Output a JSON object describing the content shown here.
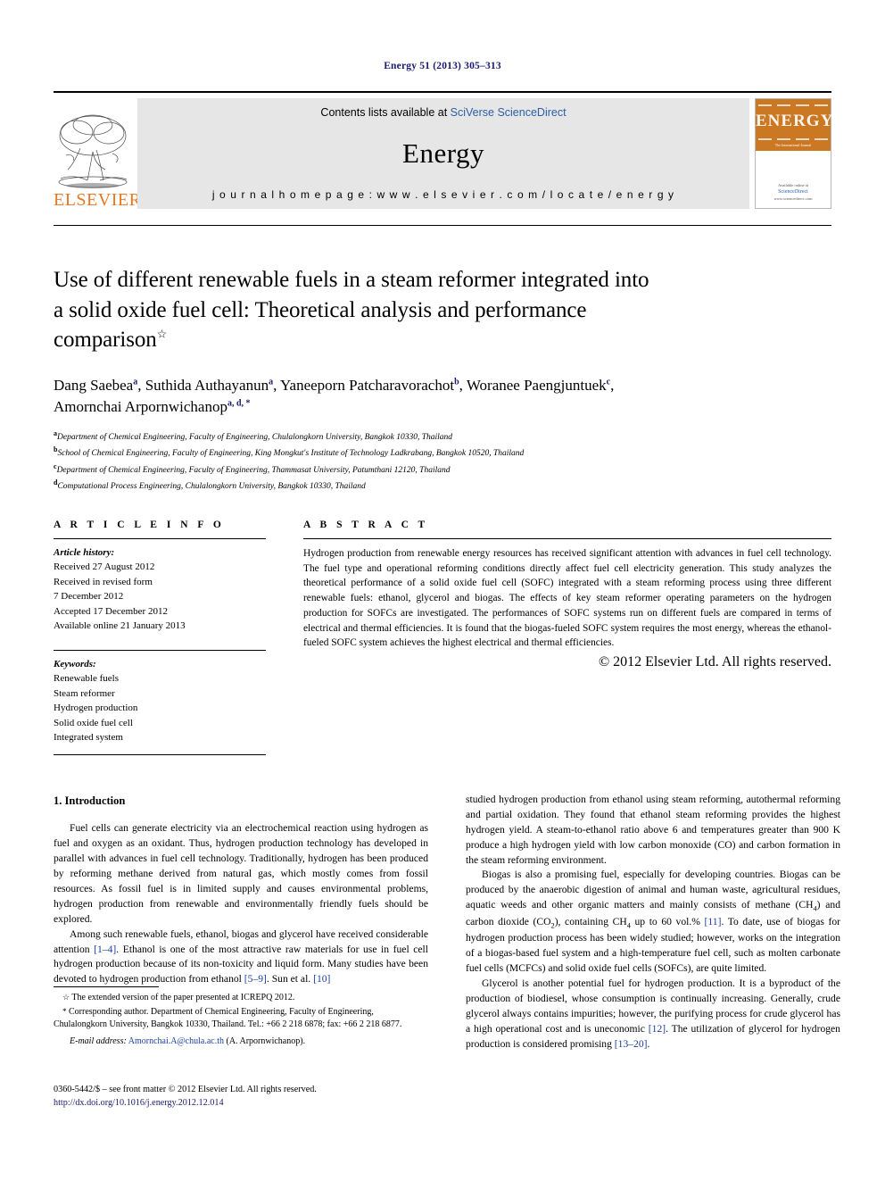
{
  "running_head": "Energy 51 (2013) 305–313",
  "banner": {
    "contents_prefix": "Contents lists available at ",
    "contents_link": "SciVerse ScienceDirect",
    "journal_name": "Energy",
    "homepage": "j o u r n a l   h o m e p a g e :   w w w . e l s e v i e r . c o m / l o c a t e / e n e r g y",
    "elsevier_wordmark": "ELSEVIER",
    "cover_masthead": "ENERGY",
    "cover_subtitle": "The International Journal",
    "cover_footer_line1": "Available online at",
    "cover_footer_link": "ScienceDirect",
    "cover_footer_line2": "www.sciencedirect.com",
    "accent_orange": "#E87722",
    "link_blue": "#2b5fa8"
  },
  "title": {
    "line1": "Use of different renewable fuels in a steam reformer integrated into",
    "line2": "a solid oxide fuel cell: Theoretical analysis and performance",
    "line3": "comparison",
    "footnote_marker": "☆"
  },
  "authors": [
    {
      "name": "Dang Saebea",
      "sup": "a",
      "sep": ", "
    },
    {
      "name": "Suthida Authayanun",
      "sup": "a",
      "sep": ", "
    },
    {
      "name": "Yaneeporn Patcharavorachot",
      "sup": "b",
      "sep": ", "
    },
    {
      "name": "Woranee Paengjuntuek",
      "sup": "c",
      "sep": ","
    },
    {
      "name": "Amornchai Arpornwichanop",
      "sup": "a, d, *",
      "sep": ""
    }
  ],
  "affiliations": [
    {
      "mark": "a",
      "text": "Department of Chemical Engineering, Faculty of Engineering, Chulalongkorn University, Bangkok 10330, Thailand"
    },
    {
      "mark": "b",
      "text": "School of Chemical Engineering, Faculty of Engineering, King Mongkut's Institute of Technology Ladkrabang, Bangkok 10520, Thailand"
    },
    {
      "mark": "c",
      "text": "Department of Chemical Engineering, Faculty of Engineering, Thammasat University, Patumthani 12120, Thailand"
    },
    {
      "mark": "d",
      "text": "Computational Process Engineering, Chulalongkorn University, Bangkok 10330, Thailand"
    }
  ],
  "article_info": {
    "heading": "A R T I C L E  I N F O",
    "history_label": "Article history:",
    "history": [
      "Received 27 August 2012",
      "Received in revised form",
      "7 December 2012",
      "Accepted 17 December 2012",
      "Available online 21 January 2013"
    ],
    "keywords_label": "Keywords:",
    "keywords": [
      "Renewable fuels",
      "Steam reformer",
      "Hydrogen production",
      "Solid oxide fuel cell",
      "Integrated system"
    ]
  },
  "abstract": {
    "heading": "A B S T R A C T",
    "text": "Hydrogen production from renewable energy resources has received significant attention with advances in fuel cell technology. The fuel type and operational reforming conditions directly affect fuel cell electricity generation. This study analyzes the theoretical performance of a solid oxide fuel cell (SOFC) integrated with a steam reforming process using three different renewable fuels: ethanol, glycerol and biogas. The effects of key steam reformer operating parameters on the hydrogen production for SOFCs are investigated. The performances of SOFC systems run on different fuels are compared in terms of electrical and thermal efficiencies. It is found that the biogas-fueled SOFC system requires the most energy, whereas the ethanol-fueled SOFC system achieves the highest electrical and thermal efficiencies.",
    "copyright": "© 2012 Elsevier Ltd. All rights reserved."
  },
  "body": {
    "section_heading": "1.  Introduction",
    "left_paragraphs": [
      "Fuel cells can generate electricity via an electrochemical reaction using hydrogen as fuel and oxygen as an oxidant. Thus, hydrogen production technology has developed in parallel with advances in fuel cell technology. Traditionally, hydrogen has been produced by reforming methane derived from natural gas, which mostly comes from fossil resources. As fossil fuel is in limited supply and causes environmental problems, hydrogen production from renewable and environmentally friendly fuels should be explored."
    ],
    "left_par2_pre": "Among such renewable fuels, ethanol, biogas and glycerol have received considerable attention ",
    "left_par2_ref1": "[1–4]",
    "left_par2_mid": ". Ethanol is one of the most attractive raw materials for use in fuel cell hydrogen production because of its non-toxicity and liquid form. Many studies have been devoted to hydrogen production from ethanol ",
    "left_par2_ref2": "[5–9]",
    "left_par2_mid2": ". Sun et al. ",
    "left_par2_ref3": "[10]",
    "right_par1_post": " studied hydrogen production from ethanol using steam reforming, autothermal reforming and partial oxidation. They found that ethanol steam reforming provides the highest hydrogen yield. A steam-to-ethanol ratio above 6 and temperatures greater than 900 K produce a high hydrogen yield with low carbon monoxide (CO) and carbon formation in the steam reforming environment.",
    "right_par2_a": "Biogas is also a promising fuel, especially for developing countries. Biogas can be produced by the anaerobic digestion of animal and human waste, agricultural residues, aquatic weeds and other organic matters and mainly consists of methane (CH",
    "right_par2_sub1": "4",
    "right_par2_b": ") and carbon dioxide (CO",
    "right_par2_sub2": "2",
    "right_par2_c": "), containing CH",
    "right_par2_sub3": "4",
    "right_par2_d": " up to 60 vol.% ",
    "right_par2_ref": "[11]",
    "right_par2_e": ". To date, use of biogas for hydrogen production process has been widely studied; however, works on the integration of a biogas-based fuel system and a high-temperature fuel cell, such as molten carbonate fuel cells (MCFCs) and solid oxide fuel cells (SOFCs), are quite limited.",
    "right_par3_a": "Glycerol is another potential fuel for hydrogen production. It is a byproduct of the production of biodiesel, whose consumption is continually increasing. Generally, crude glycerol always contains impurities; however, the purifying process for crude glycerol has a high operational cost and is uneconomic ",
    "right_par3_ref1": "[12]",
    "right_par3_b": ". The utilization of glycerol for hydrogen production is considered promising ",
    "right_par3_ref2": "[13–20]",
    "right_par3_c": "."
  },
  "footnotes": {
    "star_mark": "☆",
    "star_text": "The extended version of the paper presented at ICREPQ 2012.",
    "corresponding_mark": "*",
    "corresponding_text": "Corresponding author. Department of Chemical Engineering, Faculty of Engineering, Chulalongkorn University, Bangkok 10330, Thailand. Tel.: +66 2 218 6878; fax: +66 2 218 6877.",
    "email_label": "E-mail address:",
    "email": "Amornchai.A@chula.ac.th",
    "email_owner": "(A. Arpornwichanop)."
  },
  "imprint": {
    "line1": "0360-5442/$ – see front matter © 2012 Elsevier Ltd. All rights reserved.",
    "doi": "http://dx.doi.org/10.1016/j.energy.2012.12.014"
  }
}
